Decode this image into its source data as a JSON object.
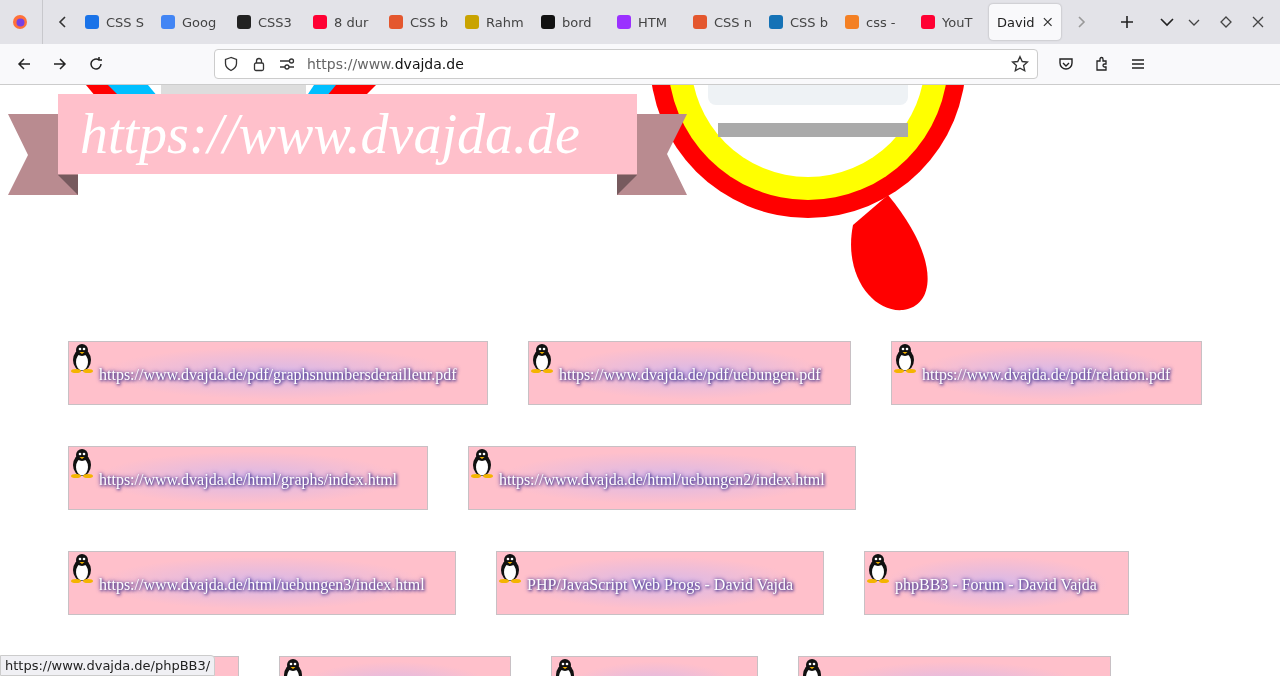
{
  "browser": {
    "tabs": [
      {
        "label": "CSS S",
        "selected": false
      },
      {
        "label": "Goog",
        "selected": false
      },
      {
        "label": "CSS3",
        "selected": false
      },
      {
        "label": "8 dur",
        "selected": false
      },
      {
        "label": "CSS b",
        "selected": false
      },
      {
        "label": "Rahm",
        "selected": false
      },
      {
        "label": "bord",
        "selected": false
      },
      {
        "label": "HTM",
        "selected": false
      },
      {
        "label": "CSS n",
        "selected": false
      },
      {
        "label": "CSS b",
        "selected": false
      },
      {
        "label": "css -",
        "selected": false
      },
      {
        "label": "YouT",
        "selected": false
      },
      {
        "label": "David",
        "selected": true
      }
    ],
    "address": {
      "prefix": "https://www.",
      "host": "dvajda.de"
    }
  },
  "page": {
    "banner": "https://www.dvajda.de",
    "link_rows": [
      [
        {
          "kind": "link",
          "label": "https://www.dvajda.de/pdf/graphsnumbersderailleur.pdf"
        },
        {
          "kind": "link",
          "label": "https://www.dvajda.de/pdf/uebungen.pdf"
        },
        {
          "kind": "link",
          "label": "https://www.dvajda.de/pdf/relation.pdf"
        }
      ],
      [
        {
          "kind": "link",
          "label": "https://www.dvajda.de/html/graphs/index.html"
        },
        {
          "kind": "link",
          "label": "https://www.dvajda.de/html/uebungen2/index.html"
        }
      ],
      [
        {
          "kind": "link",
          "label": "https://www.dvajda.de/html/uebungen3/index.html"
        },
        {
          "kind": "link",
          "label": "PHP/JavaScript Web Progs - David Vajda"
        },
        {
          "kind": "link",
          "label": "phpBB3 - Forum - David Vajda"
        }
      ],
      [
        {
          "kind": "cut"
        },
        {
          "kind": "cut"
        },
        {
          "kind": "cut"
        },
        {
          "kind": "cut"
        }
      ]
    ]
  },
  "status_bar": {
    "text": "https://www.dvajda.de/phpBB3/"
  }
}
